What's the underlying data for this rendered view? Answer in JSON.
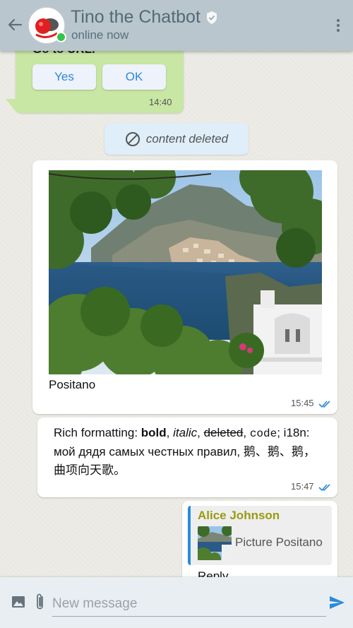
{
  "header": {
    "title": "Tino the Chatbot",
    "status": "online now",
    "verified": true
  },
  "messages": {
    "msg1": {
      "partial_text": "Go to URL.",
      "buttons": [
        "Yes",
        "OK"
      ],
      "time": "14:40"
    },
    "deleted": {
      "text": "content deleted"
    },
    "msg3": {
      "caption": "Positano",
      "time": "15:45"
    },
    "msg4": {
      "rich_prefix": "Rich formatting: ",
      "bold": "bold",
      "sep1": ", ",
      "italic": "italic",
      "sep2": ", ",
      "deleted": "deleted",
      "sep3": ", ",
      "code": "code",
      "suffix": "; i18n: мой дядя самых честных правил, 鹅、鹅、鹅，曲项向天歌。",
      "time": "15:47"
    },
    "msg5": {
      "quote_author": "Alice Johnson",
      "quote_text": "Picture Positano",
      "reply": "Reply"
    }
  },
  "composer": {
    "placeholder": "New message"
  },
  "colors": {
    "header_bg": "#b9c6cd",
    "outgoing_bubble": "#c8e6a4",
    "incoming_bubble": "#ffffff",
    "accent": "#2a8ad9",
    "online": "#37c24a",
    "quote_author": "#9a9a12"
  }
}
